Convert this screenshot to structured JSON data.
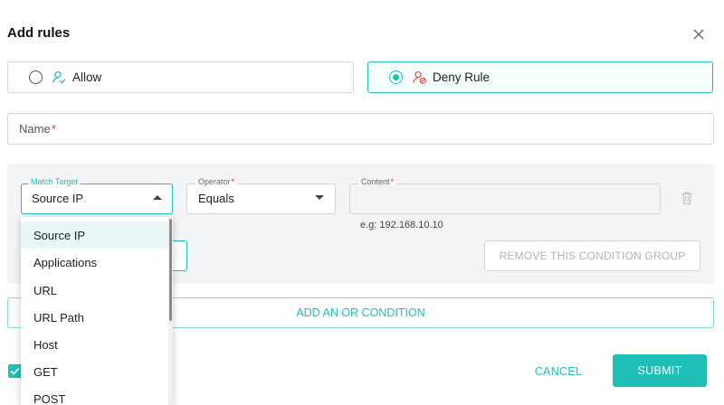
{
  "dialog": {
    "title": "Add rules"
  },
  "rule_type": {
    "allow_label": "Allow",
    "deny_label": "Deny Rule",
    "selected": "Deny Rule"
  },
  "name_field": {
    "label": "Name",
    "required_mark": "*"
  },
  "condition": {
    "match_target": {
      "label": "Match Target",
      "value": "Source IP"
    },
    "operator": {
      "label": "Operator",
      "required_mark": "*",
      "value": "Equals"
    },
    "content": {
      "label": "Content",
      "required_mark": "*",
      "hint": "e.g: 192.168.10.10"
    },
    "remove_group_label": "REMOVE THIS CONDITION GROUP"
  },
  "add_or_label": "ADD AN OR CONDITION",
  "footer": {
    "cancel_label": "CANCEL",
    "submit_label": "SUBMIT"
  },
  "dropdown": {
    "options": [
      "Source IP",
      "Applications",
      "URL",
      "URL Path",
      "Host",
      "GET",
      "POST"
    ],
    "selected_index": 0
  },
  "colors": {
    "accent": "#1fbfb8",
    "required": "#e03a3a",
    "deny_icon": "#e05a5a",
    "allow_icon": "#1fbfb8"
  }
}
